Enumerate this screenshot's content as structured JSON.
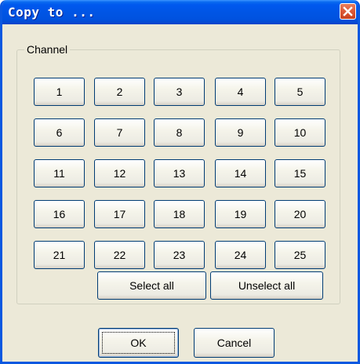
{
  "window": {
    "title": "Copy to ...",
    "close_icon": "close-icon"
  },
  "channel_group": {
    "label": "Channel",
    "channels": [
      "1",
      "2",
      "3",
      "4",
      "5",
      "6",
      "7",
      "8",
      "9",
      "10",
      "11",
      "12",
      "13",
      "14",
      "15",
      "16",
      "17",
      "18",
      "19",
      "20",
      "21",
      "22",
      "23",
      "24",
      "25"
    ],
    "select_all_label": "Select all",
    "unselect_all_label": "Unselect all"
  },
  "footer": {
    "ok_label": "OK",
    "cancel_label": "Cancel"
  },
  "colors": {
    "titlebar": "#0055E5",
    "dialog_bg": "#ECE9D8",
    "button_border": "#003C74",
    "close_button": "#DE5B3A"
  }
}
